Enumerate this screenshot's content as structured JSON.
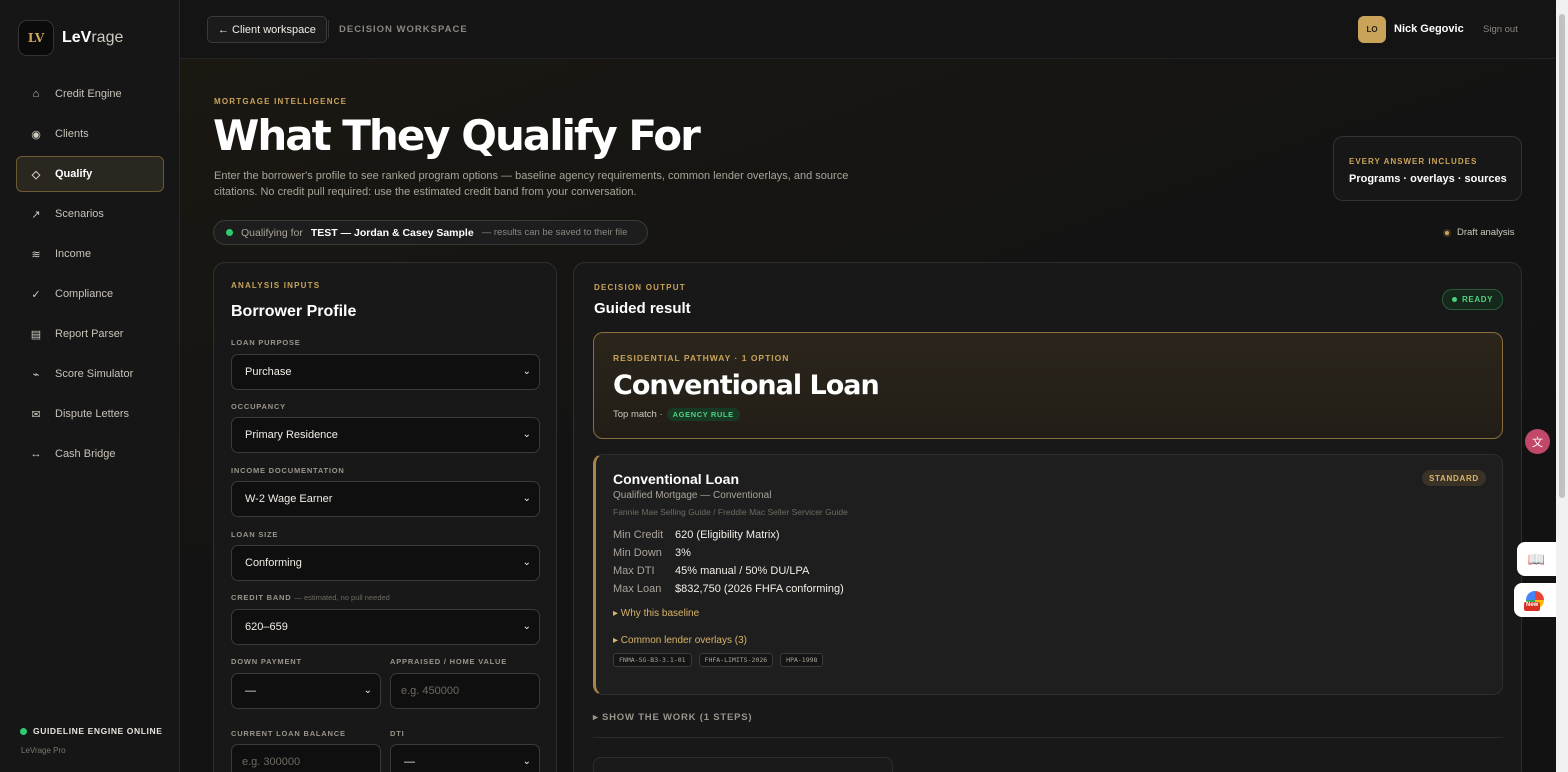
{
  "brand": {
    "logo_text": "LV",
    "name_bold": "LeV",
    "name_rest": "rage"
  },
  "sidebar": {
    "items": [
      {
        "label": "Credit Engine",
        "icon": "home-icon",
        "glyph": "⌂"
      },
      {
        "label": "Clients",
        "icon": "clients-icon",
        "glyph": "◉"
      },
      {
        "label": "Qualify",
        "icon": "diamond-icon",
        "glyph": "◇",
        "active": true
      },
      {
        "label": "Scenarios",
        "icon": "trend-arrow-icon",
        "glyph": "↗"
      },
      {
        "label": "Income",
        "icon": "waves-icon",
        "glyph": "≋"
      },
      {
        "label": "Compliance",
        "icon": "check-icon",
        "glyph": "✓"
      },
      {
        "label": "Report Parser",
        "icon": "document-icon",
        "glyph": "▤"
      },
      {
        "label": "Score Simulator",
        "icon": "pulse-icon",
        "glyph": "⌁"
      },
      {
        "label": "Dispute Letters",
        "icon": "envelope-icon",
        "glyph": "✉"
      },
      {
        "label": "Cash Bridge",
        "icon": "arrows-horizontal-icon",
        "glyph": "↔"
      }
    ],
    "engine_status": "GUIDELINE ENGINE ONLINE",
    "plan": "LeVrage Pro"
  },
  "topbar": {
    "back_label": "← Client workspace",
    "crumb": "DECISION WORKSPACE",
    "avatar_initials": "LO",
    "user_name": "Nick Gegovic",
    "signout": "Sign out"
  },
  "header": {
    "eyebrow": "MORTGAGE INTELLIGENCE",
    "title": "What They Qualify For",
    "description": "Enter the borrower's profile to see ranked program options — baseline agency requirements, common lender overlays, and source citations. No credit pull required: use the estimated credit band from your conversation.",
    "every_eyebrow": "EVERY ANSWER INCLUDES",
    "every_text": "Programs · overlays · sources",
    "qualifying_prefix": "Qualifying for",
    "qualifying_client": "TEST — Jordan & Casey Sample",
    "qualifying_suffix": "— results can be saved to their file",
    "draft_status": "Draft analysis"
  },
  "inputs": {
    "eyebrow": "ANALYSIS INPUTS",
    "title": "Borrower Profile",
    "loan_purpose": {
      "label": "LOAN PURPOSE",
      "value": "Purchase"
    },
    "occupancy": {
      "label": "OCCUPANCY",
      "value": "Primary Residence"
    },
    "income_doc": {
      "label": "INCOME DOCUMENTATION",
      "value": "W-2 Wage Earner"
    },
    "loan_size": {
      "label": "LOAN SIZE",
      "value": "Conforming"
    },
    "credit_band": {
      "label": "CREDIT BAND",
      "note": "— estimated, no pull needed",
      "value": "620–659"
    },
    "down_payment": {
      "label": "DOWN PAYMENT",
      "value": "—"
    },
    "home_value": {
      "label": "APPRAISED / HOME VALUE",
      "placeholder": "e.g. 450000"
    },
    "loan_balance": {
      "label": "CURRENT LOAN BALANCE",
      "placeholder": "e.g. 300000"
    },
    "dti": {
      "label": "DTI",
      "value": "—"
    }
  },
  "output": {
    "eyebrow": "DECISION OUTPUT",
    "title": "Guided result",
    "status": "READY",
    "pathway": {
      "eyebrow": "RESIDENTIAL PATHWAY · 1 OPTION",
      "title": "Conventional Loan",
      "sub": "Top match ·",
      "badge": "AGENCY RULE"
    },
    "card": {
      "title": "Conventional Loan",
      "badge": "STANDARD",
      "subtitle": "Qualified Mortgage — Conventional",
      "source": "Fannie Mae Selling Guide / Freddie Mac Seller Servicer Guide",
      "rows": [
        {
          "k": "Min Credit",
          "v": "620 (Eligibility Matrix)"
        },
        {
          "k": "Min Down",
          "v": "3%"
        },
        {
          "k": "Max DTI",
          "v": "45% manual / 50% DU/LPA"
        },
        {
          "k": "Max Loan",
          "v": "$832,750 (2026 FHFA conforming)"
        }
      ],
      "why": "▸  Why this baseline",
      "overlays": "▸  Common lender overlays (3)",
      "tags": [
        "FNMA-SG-B3-3.1-01",
        "FHFA-LIMITS-2026",
        "HPA-1998"
      ]
    },
    "show_work": "▸  SHOW THE WORK (1 STEPS)"
  },
  "floating": {
    "translate_glyph": "文",
    "book_glyph": "📖",
    "new_label": "New"
  }
}
